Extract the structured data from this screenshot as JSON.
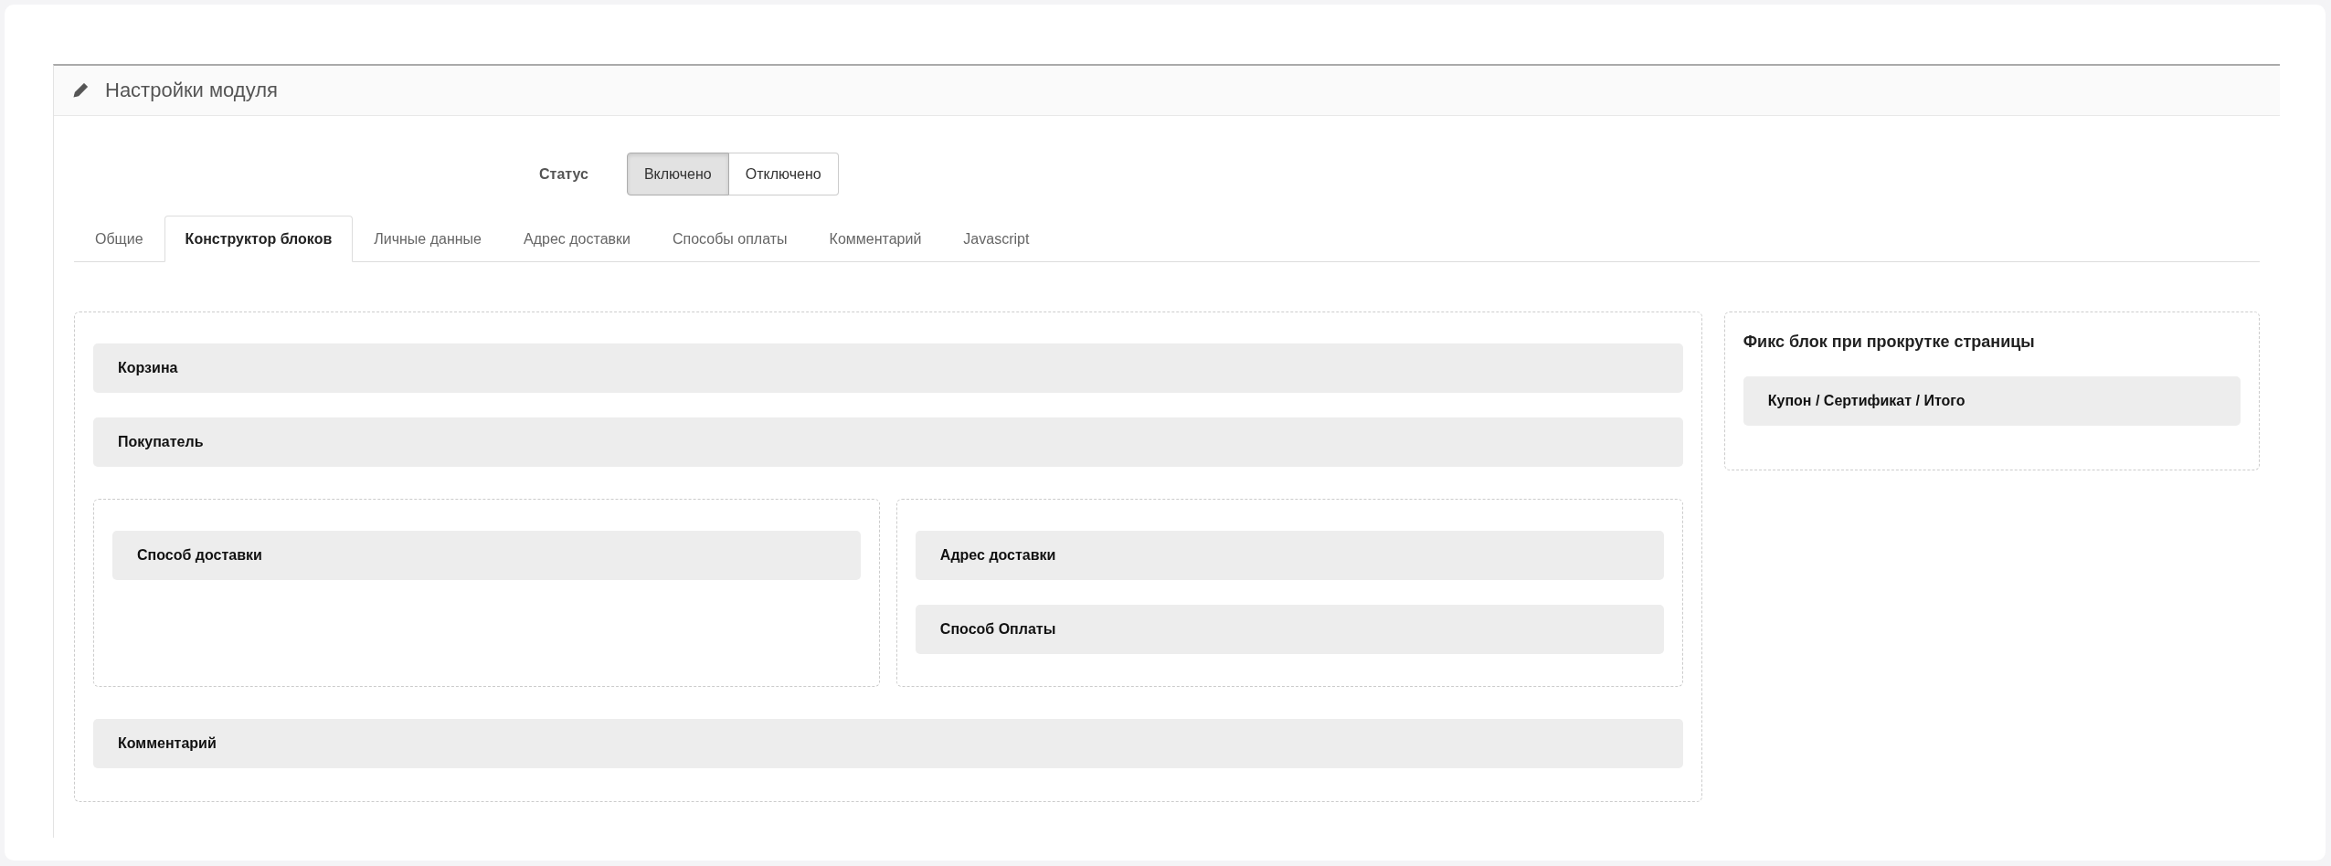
{
  "panel": {
    "title": "Настройки модуля"
  },
  "status": {
    "label": "Статус",
    "options": [
      {
        "label": "Включено",
        "selected": true
      },
      {
        "label": "Отключено",
        "selected": false
      }
    ]
  },
  "tabs": [
    {
      "label": "Общие",
      "selected": false
    },
    {
      "label": "Конструктор блоков",
      "selected": true
    },
    {
      "label": "Личные данные",
      "selected": false
    },
    {
      "label": "Адрес доставки",
      "selected": false
    },
    {
      "label": "Способы оплаты",
      "selected": false
    },
    {
      "label": "Комментарий",
      "selected": false
    },
    {
      "label": "Javascript",
      "selected": false
    }
  ],
  "builder": {
    "rows": [
      {
        "kind": "block",
        "label": "Корзина"
      },
      {
        "kind": "block",
        "label": "Покупатель"
      },
      {
        "kind": "columns",
        "columns": [
          {
            "blocks": [
              "Способ доставки"
            ]
          },
          {
            "blocks": [
              "Адрес доставки",
              "Способ Оплаты"
            ]
          }
        ]
      },
      {
        "kind": "block",
        "label": "Комментарий"
      }
    ]
  },
  "fixed_panel": {
    "title": "Фикс блок при прокрутке страницы",
    "blocks": [
      "Купон / Сертификат / Итого"
    ]
  }
}
